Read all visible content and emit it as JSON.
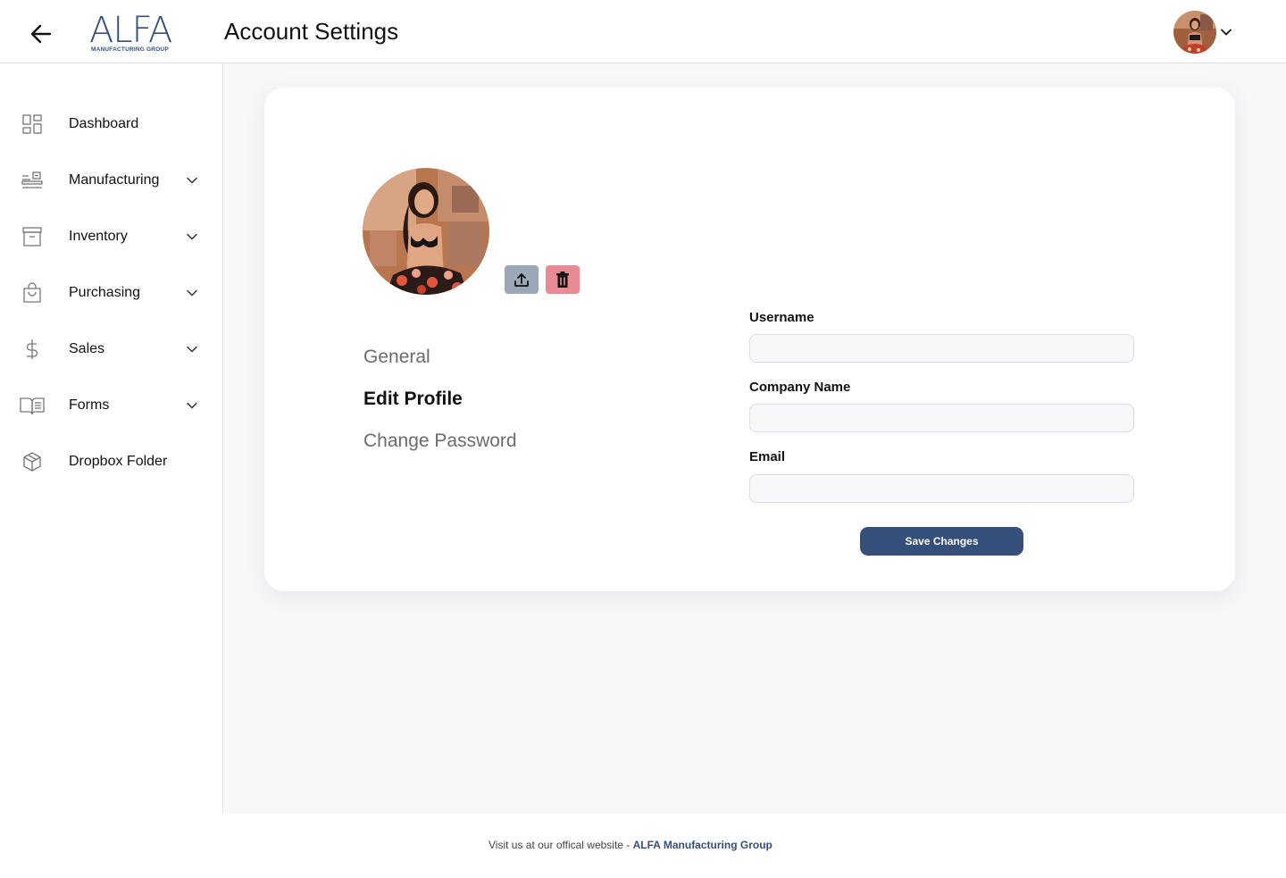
{
  "header": {
    "title": "Account Settings",
    "logo": {
      "word": "ALFA",
      "tagline": "MANUFACTURING GROUP"
    },
    "back_icon": "arrow-left-icon",
    "user_menu_icon": "chevron-down-icon"
  },
  "sidebar": {
    "items": [
      {
        "label": "Dashboard",
        "icon": "dashboard-grid-icon",
        "expandable": false
      },
      {
        "label": "Manufacturing",
        "icon": "manufacturing-icon",
        "expandable": true
      },
      {
        "label": "Inventory",
        "icon": "archive-box-icon",
        "expandable": true
      },
      {
        "label": "Purchasing",
        "icon": "shopping-bag-icon",
        "expandable": true
      },
      {
        "label": "Sales",
        "icon": "dollar-icon",
        "expandable": true
      },
      {
        "label": "Forms",
        "icon": "open-book-icon",
        "expandable": true
      },
      {
        "label": "Dropbox Folder",
        "icon": "package-box-icon",
        "expandable": false
      }
    ]
  },
  "profile": {
    "upload_icon": "upload-icon",
    "delete_icon": "trash-icon",
    "menu": [
      {
        "label": "General"
      },
      {
        "label": "Edit Profile",
        "active": true
      },
      {
        "label": "Change Password"
      }
    ]
  },
  "form": {
    "username_label": "Username",
    "username_value": "",
    "company_label": "Company Name",
    "company_value": "",
    "email_label": "Email",
    "email_value": "",
    "save_label": "Save Changes"
  },
  "footer": {
    "text": "Visit us at our offical website - ",
    "link_text": "ALFA Manufacturing Group"
  },
  "colors": {
    "brand": "#34507a",
    "upload_bg": "#9aa8b8",
    "delete_bg": "#e98b92",
    "content_bg": "#f7f8fa"
  }
}
